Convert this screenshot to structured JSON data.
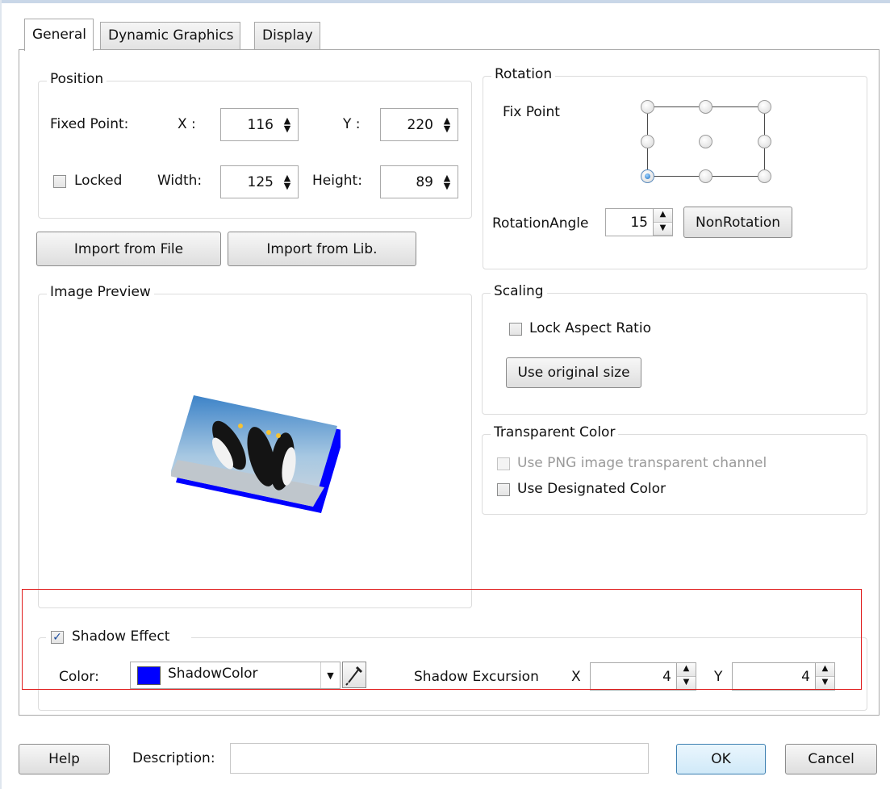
{
  "tabs": [
    "General",
    "Dynamic Graphics",
    "Display"
  ],
  "position": {
    "legend": "Position",
    "fixed_point_label": "Fixed Point:",
    "x_label": "X :",
    "x_value": "116",
    "y_label": "Y :",
    "y_value": "220",
    "locked_label": "Locked",
    "locked_checked": false,
    "width_label": "Width:",
    "width_value": "125",
    "height_label": "Height:",
    "height_value": "89"
  },
  "buttons": {
    "import_file": "Import from File",
    "import_lib": "Import from Lib."
  },
  "preview": {
    "legend": "Image Preview",
    "shadow_color": "#0000ff"
  },
  "rotation": {
    "legend": "Rotation",
    "fix_point_label": "Fix Point",
    "selected_point": "bottom-left",
    "angle_label": "RotationAngle",
    "angle_value": "15",
    "non_rotation_button": "NonRotation"
  },
  "scaling": {
    "legend": "Scaling",
    "lock_aspect_label": "Lock Aspect Ratio",
    "lock_aspect_checked": false,
    "original_size_button": "Use original size"
  },
  "transparent": {
    "legend": "Transparent Color",
    "png_channel_label": "Use PNG image transparent channel",
    "png_channel_enabled": false,
    "designated_label": "Use Designated Color",
    "designated_checked": false
  },
  "shadow": {
    "legend": "Shadow Effect",
    "enabled": true,
    "color_label": "Color:",
    "color_name": "ShadowColor",
    "color_hex": "#0000ff",
    "excursion_label": "Shadow Excursion",
    "x_label": "X",
    "x_value": "4",
    "y_label": "Y",
    "y_value": "4"
  },
  "footer": {
    "help": "Help",
    "description_label": "Description:",
    "description_value": "",
    "ok": "OK",
    "cancel": "Cancel"
  },
  "highlight_color": "#e01b1b"
}
